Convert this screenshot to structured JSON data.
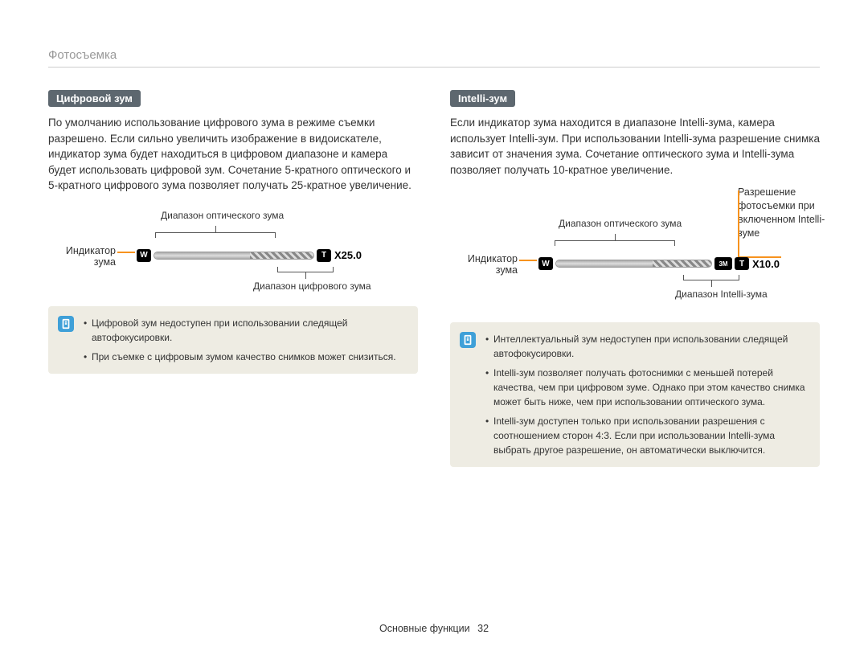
{
  "section_title": "Фотосъемка",
  "left": {
    "heading": "Цифровой зум",
    "body": "По умолчанию использование цифрового зума в режиме съемки разрешено. Если сильно увеличить изображение в видоискателе, индикатор зума будет находиться в цифровом диапазоне и камера будет использовать цифровой зум. Сочетание 5-кратного оптического и 5-кратного цифрового зума позволяет получать 25-кратное увеличение.",
    "diagram": {
      "optical_label": "Диапазон оптического зума",
      "indicator_label": "Индикатор зума",
      "digital_label": "Диапазон цифрового зума",
      "w_icon": "W",
      "t_icon": "T",
      "zoom_value": "X25.0"
    },
    "notes": [
      "Цифровой зум недоступен при использовании следящей автофокусировки.",
      "При съемке с цифровым зумом качество снимков может снизиться."
    ]
  },
  "right": {
    "heading": "Intelli-зум",
    "body": "Если индикатор зума находится в диапазоне Intelli-зума, камера использует Intelli-зум. При использовании Intelli-зума разрешение снимка зависит от значения зума. Сочетание оптического зума и Intelli-зума позволяет получать 10-кратное увеличение.",
    "diagram": {
      "optical_label": "Диапазон оптического зума",
      "indicator_label": "Индикатор зума",
      "intelli_label": "Диапазон Intelli-зума",
      "w_icon": "W",
      "t_icon": "T",
      "res_icon": "3M",
      "zoom_value": "X10.0",
      "resolution_label": "Разрешение фотосъемки при включенном Intelli-зуме"
    },
    "notes": [
      "Интеллектуальный зум недоступен при использовании следящей автофокусировки.",
      "Intelli-зум позволяет получать фотоснимки с меньшей потерей качества, чем при цифровом зуме. Однако при этом качество снимка может быть ниже, чем при использовании оптического зума.",
      "Intelli-зум доступен только при использовании разрешения с соотношением сторон 4:3. Если при использовании Intelli-зума выбрать другое разрешение, он автоматически выключится."
    ]
  },
  "footer": {
    "section": "Основные функции",
    "page": "32"
  }
}
